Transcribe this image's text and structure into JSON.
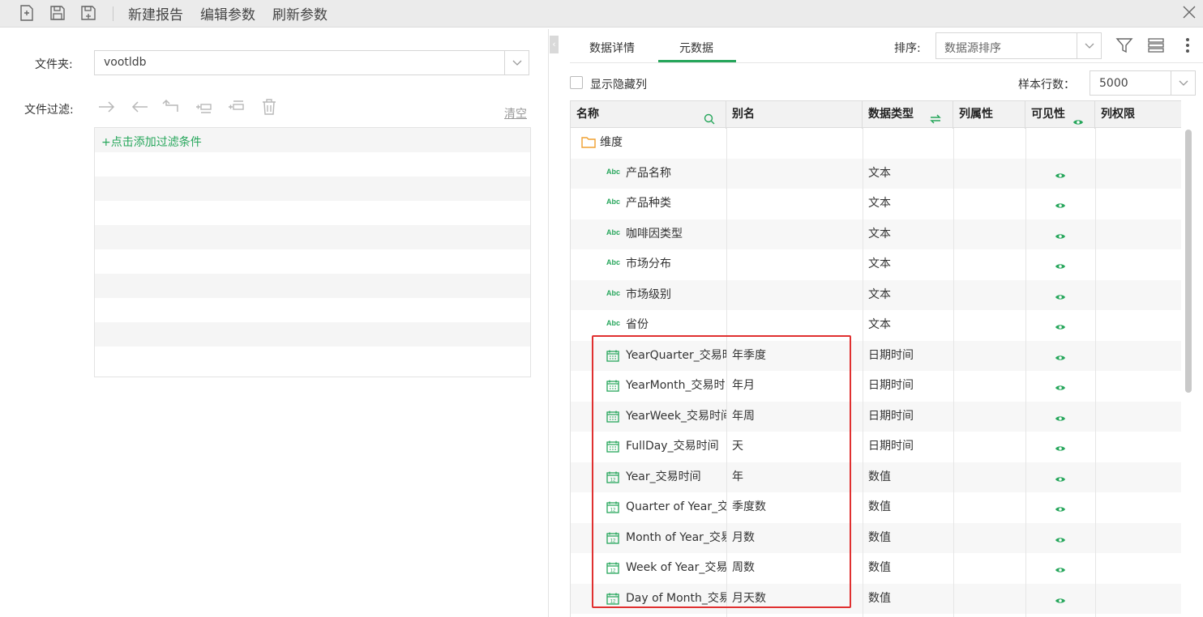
{
  "toolbar": {
    "new_report": "新建报告",
    "edit_params": "编辑参数",
    "refresh_params": "刷新参数"
  },
  "left": {
    "folder_label": "文件夹:",
    "folder_value": "vootldb",
    "filter_label": "文件过滤:",
    "clear_label": "清空",
    "add_filter": "+点击添加过滤条件"
  },
  "right": {
    "tabs": [
      {
        "label": "数据详情",
        "active": false
      },
      {
        "label": "元数据",
        "active": true
      }
    ],
    "sort_label": "排序:",
    "sort_value": "数据源排序",
    "show_hidden_label": "显示隐藏列",
    "sample_rows_label": "样本行数：",
    "sample_rows_value": "5000",
    "accent_color": "#26a65b",
    "highlight_color": "#e03030"
  },
  "grid": {
    "headers": [
      "名称",
      "别名",
      "数据类型",
      "列属性",
      "可见性",
      "列权限"
    ],
    "folder_row": "维度",
    "rows": [
      {
        "icon": "abc-text-icon",
        "name": "产品名称",
        "alias": "",
        "type": "文本"
      },
      {
        "icon": "abc-text-icon",
        "name": "产品种类",
        "alias": "",
        "type": "文本"
      },
      {
        "icon": "abc-text-icon",
        "name": "咖啡因类型",
        "alias": "",
        "type": "文本"
      },
      {
        "icon": "abc-text-icon",
        "name": "市场分布",
        "alias": "",
        "type": "文本"
      },
      {
        "icon": "abc-text-icon",
        "name": "市场级别",
        "alias": "",
        "type": "文本"
      },
      {
        "icon": "abc-text-icon",
        "name": "省份",
        "alias": "",
        "type": "文本"
      },
      {
        "icon": "calendar-datetime-icon",
        "name": "YearQuarter_交易时",
        "alias": "年季度",
        "type": "日期时间"
      },
      {
        "icon": "calendar-datetime-icon",
        "name": "YearMonth_交易时",
        "alias": "年月",
        "type": "日期时间"
      },
      {
        "icon": "calendar-datetime-icon",
        "name": "YearWeek_交易时间",
        "alias": "年周",
        "type": "日期时间"
      },
      {
        "icon": "calendar-datetime-icon",
        "name": "FullDay_交易时间",
        "alias": "天",
        "type": "日期时间"
      },
      {
        "icon": "calendar-number-icon",
        "name": "Year_交易时间",
        "alias": "年",
        "type": "数值"
      },
      {
        "icon": "calendar-number-icon",
        "name": "Quarter of Year_交易",
        "alias": "季度数",
        "type": "数值"
      },
      {
        "icon": "calendar-number-icon",
        "name": "Month of Year_交易",
        "alias": "月数",
        "type": "数值"
      },
      {
        "icon": "calendar-number-icon",
        "name": "Week of Year_交易",
        "alias": "周数",
        "type": "数值"
      },
      {
        "icon": "calendar-number-icon",
        "name": "Day of Month_交易",
        "alias": "月天数",
        "type": "数值"
      }
    ]
  }
}
